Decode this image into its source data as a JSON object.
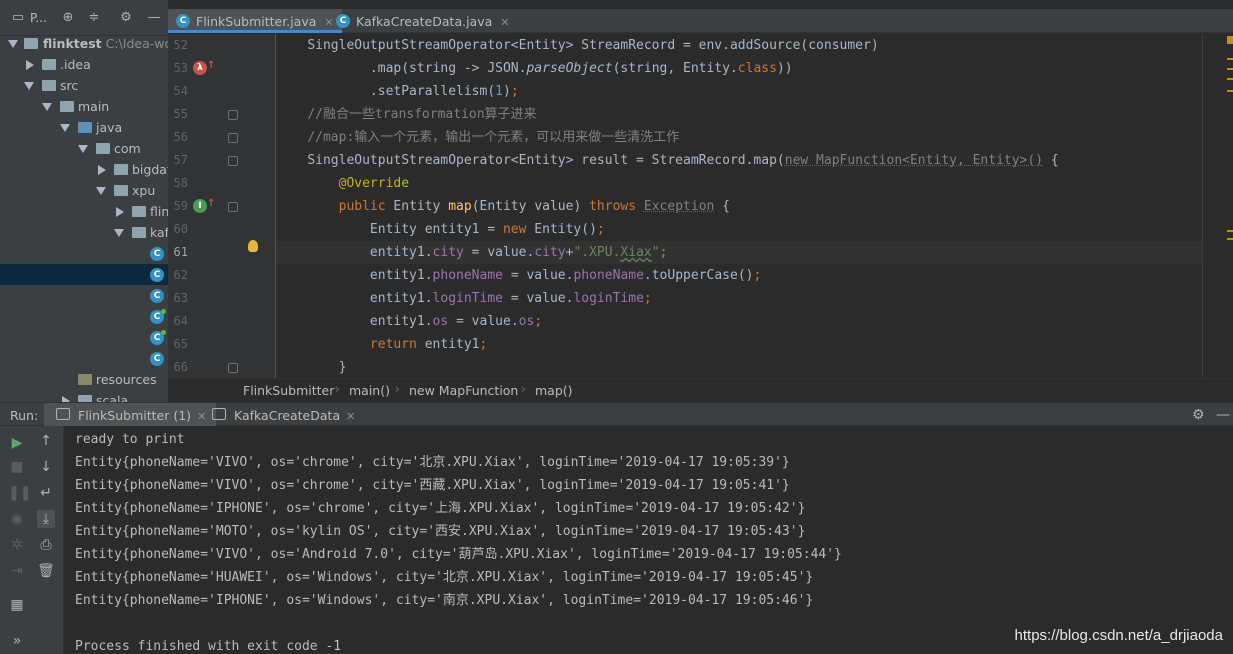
{
  "project_panel": {
    "title": "P...",
    "tree": [
      {
        "label": "flinktest",
        "path": "C:\\Idea-wor",
        "kind": "module"
      },
      {
        "label": ".idea",
        "kind": "folder"
      },
      {
        "label": "src",
        "kind": "folder"
      },
      {
        "label": "main",
        "kind": "folder"
      },
      {
        "label": "java",
        "kind": "source-folder"
      },
      {
        "label": "com",
        "kind": "package"
      },
      {
        "label": "bigdat",
        "kind": "package"
      },
      {
        "label": "xpu",
        "kind": "package"
      },
      {
        "label": "flin",
        "kind": "package"
      },
      {
        "label": "kaf",
        "kind": "package"
      },
      {
        "label": "resources",
        "kind": "resources-folder"
      },
      {
        "label": "scala",
        "kind": "folder"
      }
    ]
  },
  "tabs": [
    {
      "label": "FlinkSubmitter.java",
      "active": true
    },
    {
      "label": "KafkaCreateData.java",
      "active": false
    }
  ],
  "editor": {
    "current_line": "61",
    "line_numbers": [
      "52",
      "53",
      "54",
      "55",
      "56",
      "57",
      "58",
      "59",
      "60",
      "61",
      "62",
      "63",
      "64",
      "65",
      "66"
    ]
  },
  "breadcrumb": [
    "FlinkSubmitter",
    "main()",
    "new MapFunction",
    "map()"
  ],
  "run_panel": {
    "label": "Run:",
    "tabs": [
      {
        "label": "FlinkSubmitter (1)",
        "active": true
      },
      {
        "label": "KafkaCreateData",
        "active": false
      }
    ],
    "console_lines": [
      "ready to print",
      "Entity{phoneName='VIVO', os='chrome', city='北京.XPU.Xiax', loginTime='2019-04-17 19:05:39'}",
      "Entity{phoneName='VIVO', os='chrome', city='西藏.XPU.Xiax', loginTime='2019-04-17 19:05:41'}",
      "Entity{phoneName='IPHONE', os='chrome', city='上海.XPU.Xiax', loginTime='2019-04-17 19:05:42'}",
      "Entity{phoneName='MOTO', os='kylin OS', city='西安.XPU.Xiax', loginTime='2019-04-17 19:05:43'}",
      "Entity{phoneName='VIVO', os='Android 7.0', city='葫芦岛.XPU.Xiax', loginTime='2019-04-17 19:05:44'}",
      "Entity{phoneName='HUAWEI', os='Windows', city='北京.XPU.Xiax', loginTime='2019-04-17 19:05:45'}",
      "Entity{phoneName='IPHONE', os='Windows', city='南京.XPU.Xiax', loginTime='2019-04-17 19:05:46'}",
      "",
      "Process finished with exit code -1"
    ]
  },
  "watermark": "https://blog.csdn.net/a_drjiaoda",
  "code_text": {
    "l52": [
      "SingleOutputStreamOperator<Entity> StreamRecord = env.addSource(consumer)"
    ],
    "l53": [
      ".map(string -> JSON.",
      "parseObject",
      "(string, Entity.",
      "class",
      "))"
    ],
    "l54": [
      ".setParallelism(",
      "1",
      ")",
      ";"
    ],
    "l55": [
      "//融合一些transformation算子进来"
    ],
    "l56": [
      "//map:输入一个元素，输出一个元素，可以用来做一些清洗工作"
    ],
    "l57": [
      "SingleOutputStreamOperator<Entity> result = StreamRecord.map(",
      "new MapFunction<Entity, Entity>()",
      " {"
    ],
    "l58": [
      "@Override"
    ],
    "l59": [
      "public",
      " Entity ",
      "map",
      "(Entity value) ",
      "throws",
      " ",
      "Exception",
      " {"
    ],
    "l60": [
      "Entity entity1 = ",
      "new",
      " Entity()",
      ";"
    ],
    "l61": [
      "entity1.",
      "city",
      " = value.",
      "city",
      "+",
      "\".XPU.",
      "Xiax",
      "\"",
      ";"
    ],
    "l62": [
      "entity1.",
      "phoneName",
      " = value.",
      "phoneName",
      ".toUpperCase()",
      ";"
    ],
    "l63": [
      "entity1.",
      "loginTime",
      " = value.",
      "loginTime",
      ";"
    ],
    "l64": [
      "entity1.",
      "os",
      " = value.",
      "os",
      ";"
    ],
    "l65": [
      "return",
      " entity1",
      ";"
    ],
    "l66": [
      "}"
    ]
  },
  "colors": {
    "keyword": "#cc7832",
    "string": "#6a8759",
    "number": "#6897bb",
    "comment": "#808080",
    "annotation": "#bbb529",
    "field": "#9876aa",
    "method_decl": "#ffc66d",
    "accent": "#4a88c7"
  }
}
